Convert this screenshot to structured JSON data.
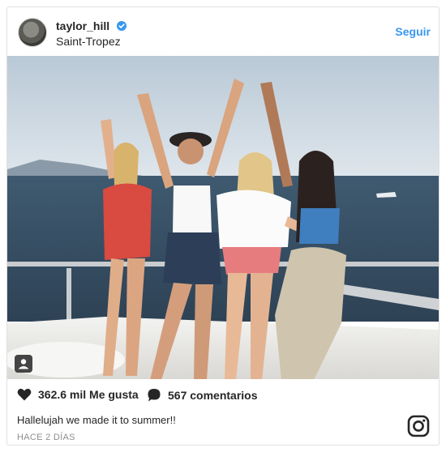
{
  "post": {
    "username": "taylor_hill",
    "location": "Saint-Tropez",
    "follow_label": "Seguir",
    "likes": "362.6 mil Me gusta",
    "comments": "567 comentarios",
    "caption": "Hallelujah we made it to summer!!",
    "timestamp": "HACE 2 DÍAS"
  },
  "icons": {
    "verified": "verified-badge-icon",
    "like": "heart-icon",
    "comment": "comment-bubble-icon",
    "photo_tag": "tagged-people-icon",
    "brand": "instagram-logo-icon"
  },
  "colors": {
    "accent": "#3897f0",
    "text": "#262626",
    "muted": "#8e8e8e"
  }
}
